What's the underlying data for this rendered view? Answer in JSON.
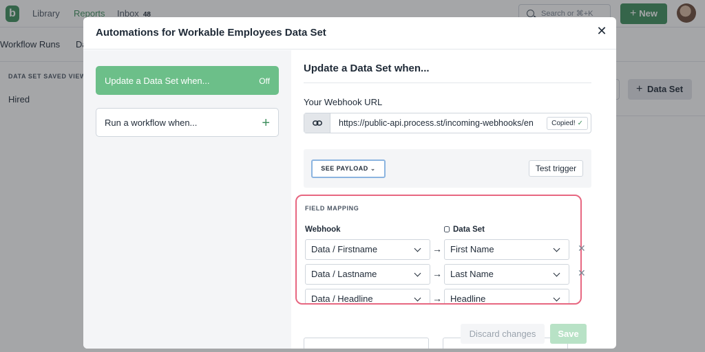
{
  "app": {
    "logo": "b",
    "nav": [
      "Library",
      "Reports",
      "Inbox"
    ],
    "inbox_count": "48",
    "search_placeholder": "Search or ⌘+K",
    "new_button": "New",
    "tabs": [
      "Workflow Runs",
      "Da"
    ],
    "sidebar_label": "DATA SET SAVED VIEW",
    "sidebar_item": "Hired",
    "add_data_set_button": "Data Set"
  },
  "modal": {
    "title": "Automations for Workable Employees Data Set",
    "close_icon": "close-icon",
    "triggers": [
      {
        "label": "Update a Data Set when...",
        "state": "Off",
        "active": true
      },
      {
        "label": "Run a workflow when...",
        "state": "",
        "active": false
      }
    ],
    "section_title": "Update a Data Set when...",
    "webhook_url_label": "Your Webhook URL",
    "webhook_url": "https://public-api.process.st/incoming-webhooks/en",
    "copied_label": "Copied!",
    "see_payload_label": "SEE PAYLOAD",
    "test_trigger_label": "Test trigger",
    "field_mapping": {
      "label": "FIELD MAPPING",
      "webhook_header": "Webhook",
      "dataset_header": "Data Set",
      "rows": [
        {
          "webhook": "Data / Firstname",
          "dataset": "First Name"
        },
        {
          "webhook": "Data / Lastname",
          "dataset": "Last Name"
        },
        {
          "webhook": "Data / Headline",
          "dataset": "Headline"
        }
      ]
    },
    "discard_label": "Discard changes",
    "save_label": "Save"
  },
  "colors": {
    "brand_green": "#3f8f5e",
    "active_trigger": "#6cbf89",
    "highlight_border": "#e76680",
    "payload_focus": "#8bb4e0"
  }
}
